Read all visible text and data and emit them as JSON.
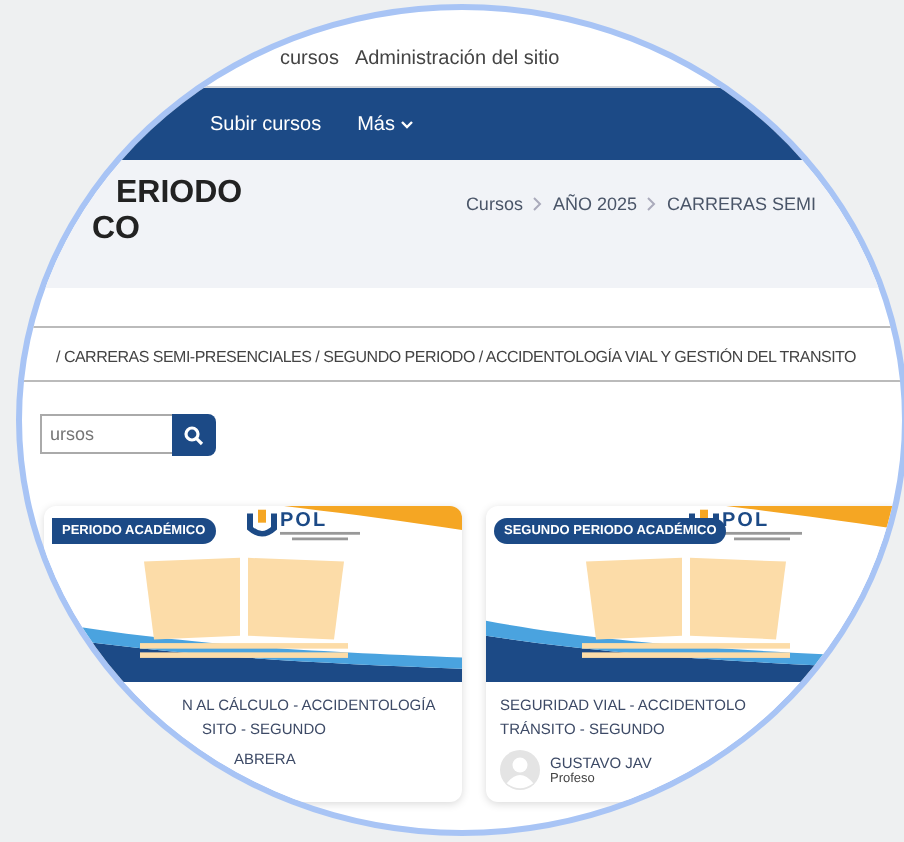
{
  "top_menu": [
    {
      "label": "cursos"
    },
    {
      "label": "Administración del sitio"
    }
  ],
  "nav": [
    {
      "label": "Subir cursos",
      "dropdown": false
    },
    {
      "label": "Más",
      "dropdown": true
    }
  ],
  "page_heading": [
    "ERIODO",
    "CO"
  ],
  "breadcrumb": [
    "Cursos",
    "AÑO 2025",
    "CARRERAS SEMI"
  ],
  "category_path": "/ CARRERAS SEMI-PRESENCIALES / SEGUNDO PERIODO / ACCIDENTOLOGÍA VIAL Y GESTIÓN DEL TRANSITO",
  "search": {
    "placeholder": "ursos"
  },
  "courses": [
    {
      "badge": "PERIODO ACADÉMICO",
      "logo": "POL",
      "title_lines": [
        "N AL CÁLCULO - ACCIDENTOLOGÍA",
        "SITO - SEGUNDO"
      ],
      "teacher": "ABRERA"
    },
    {
      "badge": "SEGUNDO PERIODO ACADÉMICO",
      "logo": "POL",
      "title_lines": [
        "SEGURIDAD VIAL - ACCIDENTOLO",
        "TRÁNSITO - SEGUNDO"
      ],
      "teacher": "GUSTAVO JAV",
      "role": "Profeso"
    }
  ]
}
